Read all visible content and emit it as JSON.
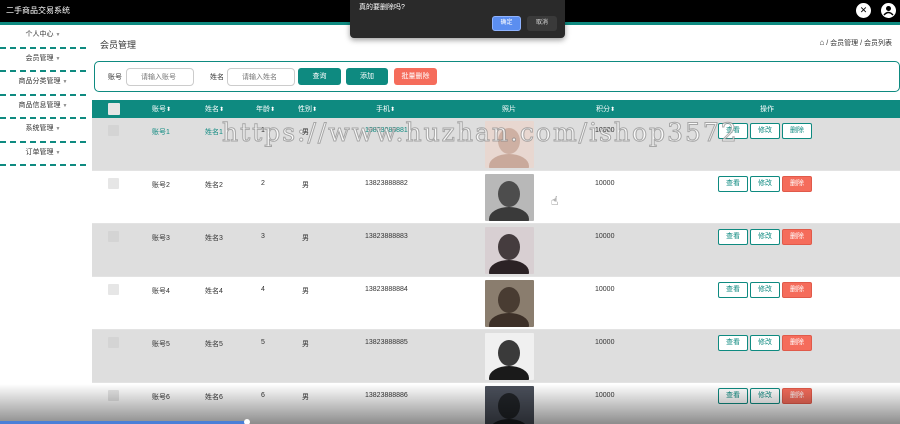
{
  "app": {
    "title": "二手商品交易系统"
  },
  "sidebar": {
    "items": [
      {
        "label": "个人中心"
      },
      {
        "label": "会员管理"
      },
      {
        "label": "商品分类管理"
      },
      {
        "label": "商品信息管理"
      },
      {
        "label": "系统管理"
      },
      {
        "label": "订单管理"
      }
    ]
  },
  "header": {
    "title": "会员管理",
    "breadcrumb_sep": "/",
    "breadcrumb": [
      "会员管理",
      "会员列表"
    ]
  },
  "search": {
    "account_label": "账号",
    "account_placeholder": "请输入账号",
    "name_label": "姓名",
    "name_placeholder": "请输入姓名",
    "query_label": "查询",
    "add_label": "添加",
    "batch_delete_label": "批量删除"
  },
  "table": {
    "headers": {
      "account": "账号",
      "name": "姓名",
      "age": "年龄",
      "gender": "性别",
      "phone": "手机",
      "photo": "照片",
      "points": "积分",
      "actions": "操作"
    },
    "action_labels": {
      "view": "查看",
      "edit": "修改",
      "delete": "删除"
    },
    "rows": [
      {
        "account": "账号1",
        "name": "姓名1",
        "age": "1",
        "gender": "男",
        "phone": "13823888881",
        "points": "10000"
      },
      {
        "account": "账号2",
        "name": "姓名2",
        "age": "2",
        "gender": "男",
        "phone": "13823888882",
        "points": "10000"
      },
      {
        "account": "账号3",
        "name": "姓名3",
        "age": "3",
        "gender": "男",
        "phone": "13823888883",
        "points": "10000"
      },
      {
        "account": "账号4",
        "name": "姓名4",
        "age": "4",
        "gender": "男",
        "phone": "13823888884",
        "points": "10000"
      },
      {
        "account": "账号5",
        "name": "姓名5",
        "age": "5",
        "gender": "男",
        "phone": "13823888885",
        "points": "10000"
      },
      {
        "account": "账号6",
        "name": "姓名6",
        "age": "6",
        "gender": "男",
        "phone": "13823888886",
        "points": "10000"
      }
    ]
  },
  "dialog": {
    "message": "真的要删除吗?",
    "confirm_label": "确定",
    "cancel_label": "取消"
  },
  "watermark": {
    "text": "https://www.huzhan.com/ishop3572"
  },
  "colors": {
    "accent": "#0e8a80",
    "danger": "#f56c5b",
    "topbar": "#000000"
  },
  "icons": {
    "close": "close-icon",
    "user": "user-icon",
    "home": "home-icon",
    "sort": "sort-icon",
    "cursor": "hand-cursor-icon"
  },
  "video_progress": 0.272
}
